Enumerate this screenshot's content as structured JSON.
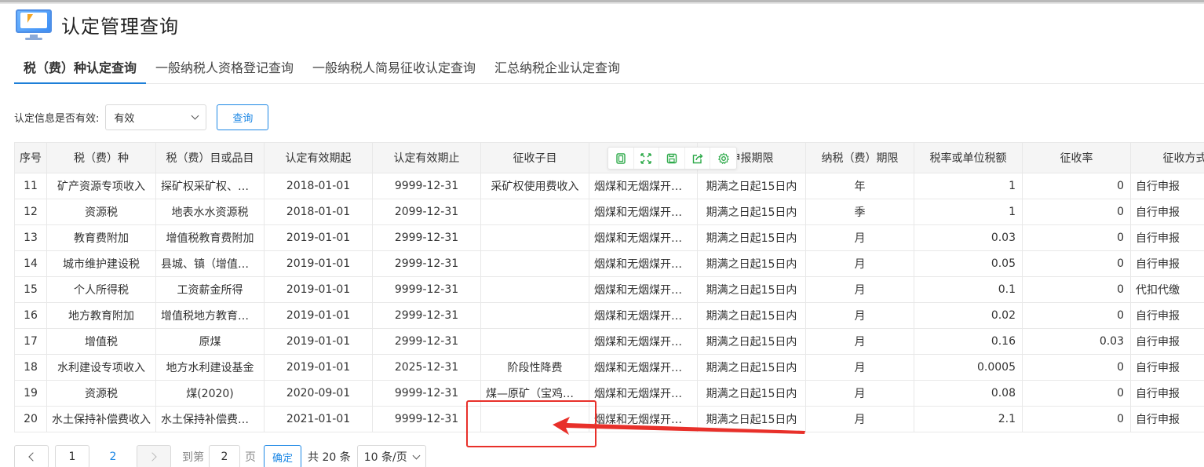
{
  "page": {
    "title": "认定管理查询"
  },
  "tabs": [
    {
      "label": "税（费）种认定查询"
    },
    {
      "label": "一般纳税人资格登记查询"
    },
    {
      "label": "一般纳税人简易征收认定查询"
    },
    {
      "label": "汇总纳税企业认定查询"
    }
  ],
  "filter": {
    "label": "认定信息是否有效:",
    "value": "有效",
    "query_label": "查询"
  },
  "table": {
    "headers": [
      "序号",
      "税（费）种",
      "税（费）目或品目",
      "认定有效期起",
      "认定有效期止",
      "征收子目",
      "",
      "申报期限",
      "纳税（费）期限",
      "税率或单位税额",
      "征收率",
      "征收方式"
    ],
    "rows": [
      [
        "11",
        "矿产资源专项收入",
        "探矿权采矿权、使用费...",
        "2018-01-01",
        "9999-12-31",
        "采矿权使用费收入",
        "烟煤和无烟煤开采...",
        "期满之日起15日内",
        "年",
        "1",
        "0",
        "自行申报"
      ],
      [
        "12",
        "资源税",
        "地表水水资源税",
        "2018-01-01",
        "2099-12-31",
        "",
        "烟煤和无烟煤开采...",
        "期满之日起15日内",
        "季",
        "1",
        "0",
        "自行申报"
      ],
      [
        "13",
        "教育费附加",
        "增值税教育费附加",
        "2019-01-01",
        "2999-12-31",
        "",
        "烟煤和无烟煤开采...",
        "期满之日起15日内",
        "月",
        "0.03",
        "0",
        "自行申报"
      ],
      [
        "14",
        "城市维护建设税",
        "县城、镇（增值税...",
        "2019-01-01",
        "2999-12-31",
        "",
        "烟煤和无烟煤开采...",
        "期满之日起15日内",
        "月",
        "0.05",
        "0",
        "自行申报"
      ],
      [
        "15",
        "个人所得税",
        "工资薪金所得",
        "2019-01-01",
        "9999-12-31",
        "",
        "烟煤和无烟煤开采...",
        "期满之日起15日内",
        "月",
        "0.1",
        "0",
        "代扣代缴"
      ],
      [
        "16",
        "地方教育附加",
        "增值税地方教育附加",
        "2019-01-01",
        "2999-12-31",
        "",
        "烟煤和无烟煤开采...",
        "期满之日起15日内",
        "月",
        "0.02",
        "0",
        "自行申报"
      ],
      [
        "17",
        "增值税",
        "原煤",
        "2019-01-01",
        "2999-12-31",
        "",
        "烟煤和无烟煤开采...",
        "期满之日起15日内",
        "月",
        "0.16",
        "0.03",
        "自行申报"
      ],
      [
        "18",
        "水利建设专项收入",
        "地方水利建设基金",
        "2019-01-01",
        "2025-12-31",
        "阶段性降费",
        "烟煤和无烟煤开采...",
        "期满之日起15日内",
        "月",
        "0.0005",
        "0",
        "自行申报"
      ],
      [
        "19",
        "资源税",
        "煤(2020)",
        "2020-09-01",
        "9999-12-31",
        "煤—原矿（宝鸡、...",
        "烟煤和无烟煤开采...",
        "期满之日起15日内",
        "月",
        "0.08",
        "0",
        "自行申报"
      ],
      [
        "20",
        "水土保持补偿费收入",
        "水土保持补偿费收...",
        "2021-01-01",
        "9999-12-31",
        "",
        "烟煤和无烟煤开采...",
        "期满之日起15日内",
        "月",
        "2.1",
        "0",
        "自行申报"
      ]
    ]
  },
  "toolbar": {
    "icons": [
      "copy-icon",
      "fullscreen-icon",
      "save-icon",
      "export-icon",
      "settings-icon"
    ],
    "color": "#2eaa4a"
  },
  "pagination": {
    "page1": "1",
    "page2": "2",
    "goto_label": "到第",
    "goto_value": "2",
    "page_suffix": "页",
    "confirm_label": "确定",
    "total": "共 20 条",
    "page_size": "10 条/页"
  },
  "colors": {
    "accent": "#1e88e5",
    "annotation": "#e8302a"
  }
}
